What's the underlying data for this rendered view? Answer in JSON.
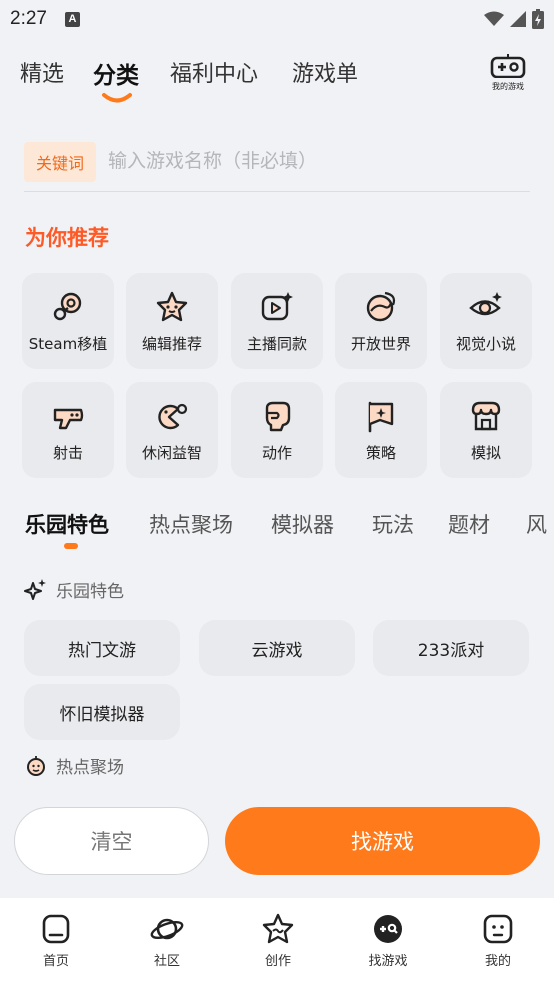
{
  "status_bar": {
    "time": "2:27",
    "notification_letter": "A"
  },
  "top_tabs": [
    "精选",
    "分类",
    "福利中心",
    "游戏单"
  ],
  "top_tabs_active": "分类",
  "my_games_label": "我的游戏",
  "search": {
    "keyword_tag": "关键词",
    "placeholder": "输入游戏名称（非必填）"
  },
  "recommend_title": "为你推荐",
  "recommend_items": [
    {
      "label": "Steam移植",
      "icon": "steam-icon"
    },
    {
      "label": "编辑推荐",
      "icon": "star-face-icon"
    },
    {
      "label": "主播同款",
      "icon": "video-play-icon"
    },
    {
      "label": "开放世界",
      "icon": "globe-icon"
    },
    {
      "label": "视觉小说",
      "icon": "eye-icon"
    },
    {
      "label": "射击",
      "icon": "gun-icon"
    },
    {
      "label": "休闲益智",
      "icon": "pacman-icon"
    },
    {
      "label": "动作",
      "icon": "fist-icon"
    },
    {
      "label": "策略",
      "icon": "flag-icon"
    },
    {
      "label": "模拟",
      "icon": "shop-icon"
    }
  ],
  "sub_tabs": [
    "乐园特色",
    "热点聚场",
    "模拟器",
    "玩法",
    "题材",
    "风"
  ],
  "sub_tabs_active": "乐园特色",
  "groups": {
    "feature": {
      "title": "乐园特色",
      "chips": [
        "热门文游",
        "云游戏",
        "233派对",
        "怀旧模拟器"
      ]
    },
    "hot": {
      "title": "热点聚场"
    }
  },
  "actions": {
    "clear": "清空",
    "find": "找游戏"
  },
  "bottom_nav": [
    "首页",
    "社区",
    "创作",
    "找游戏",
    "我的"
  ],
  "colors": {
    "accent": "#ff7a1a",
    "title_red": "#ff5a26",
    "card_bg": "#e9eaed"
  }
}
